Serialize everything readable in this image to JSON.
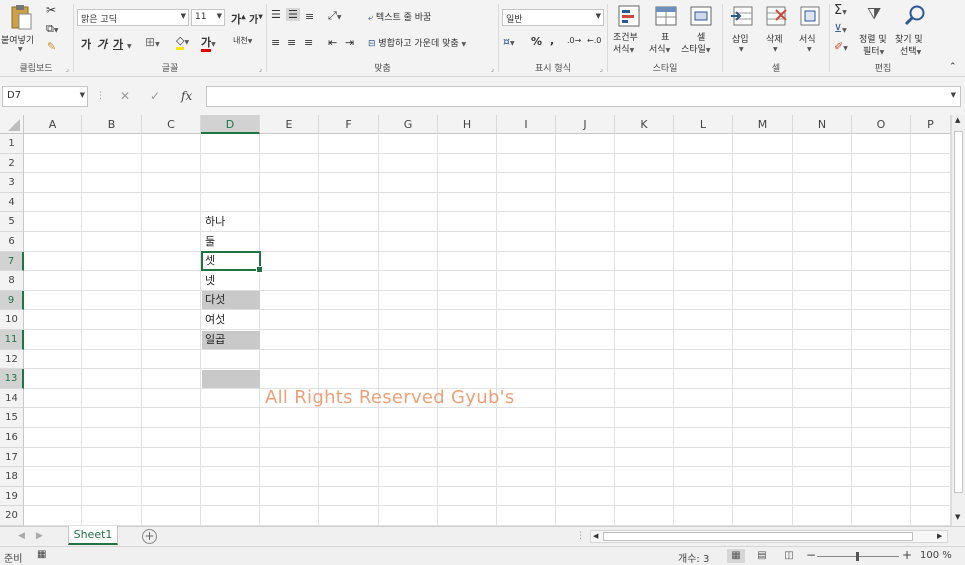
{
  "ribbon": {
    "clipboard": {
      "paste_label": "붙여넣기",
      "group_label": "클립보드"
    },
    "font": {
      "font_name": "맑은 고딕",
      "font_size": "11",
      "group_label": "글꼴",
      "bold": "가",
      "italic": "가",
      "underline": "가",
      "grow": "가",
      "shrink": "가",
      "font_color_glyph": "가",
      "phonetic": "내천"
    },
    "alignment": {
      "wrap_text": "텍스트 줄 바꿈",
      "merge_center": "병합하고 가운데 맞춤",
      "group_label": "맞춤"
    },
    "number": {
      "format": "일반",
      "percent": "%",
      "comma": ",",
      "group_label": "표시 형식"
    },
    "styles": {
      "conditional": "조건부 서식",
      "conditional_l1": "조건부",
      "conditional_l2": "서식",
      "table_l1": "표",
      "table_l2": "서식",
      "cell_l1": "셀",
      "cell_l2": "스타일",
      "group_label": "스타일"
    },
    "cells": {
      "insert": "삽입",
      "delete": "삭제",
      "format": "서식",
      "group_label": "셀"
    },
    "editing": {
      "sort_l1": "정렬 및",
      "sort_l2": "필터",
      "find_l1": "찾기 및",
      "find_l2": "선택",
      "group_label": "편집"
    }
  },
  "formula_bar": {
    "name_box": "D7",
    "formula": ""
  },
  "grid": {
    "columns": [
      "A",
      "B",
      "C",
      "D",
      "E",
      "F",
      "G",
      "H",
      "I",
      "J",
      "K",
      "L",
      "M",
      "N",
      "O",
      "P"
    ],
    "rows": [
      "1",
      "2",
      "3",
      "4",
      "5",
      "6",
      "7",
      "8",
      "9",
      "10",
      "11",
      "12",
      "13",
      "14",
      "15",
      "16",
      "17",
      "18",
      "19",
      "20"
    ],
    "cells": {
      "D5": "하나",
      "D6": "둘",
      "D7": "셋",
      "D8": "넷",
      "D9": "다섯",
      "D10": "여섯",
      "D11": "일곱"
    },
    "watermark": "All Rights Reserved Gyub's"
  },
  "sheets": {
    "tabs": [
      "Sheet1"
    ]
  },
  "status": {
    "ready": "준비",
    "count": "개수: 3",
    "zoom": "100 %"
  },
  "colors": {
    "accent": "#217346",
    "highlight": "#c9c9c9",
    "watermark": "#f0a078"
  }
}
